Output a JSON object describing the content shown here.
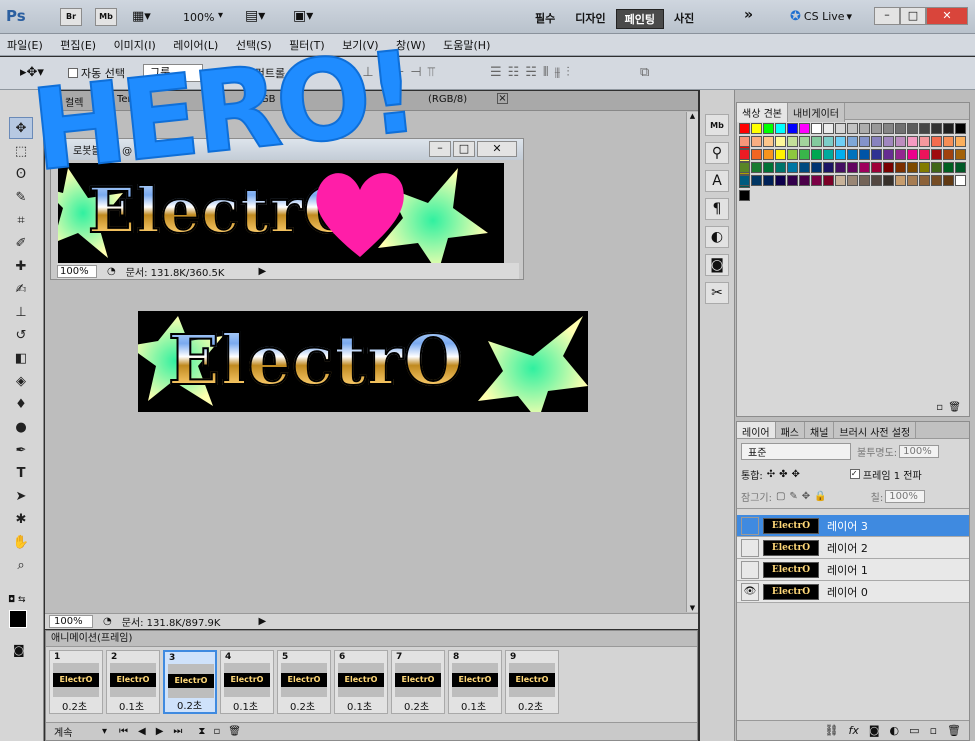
{
  "app": {
    "logo": "Ps",
    "bridge": "Br",
    "minibridge": "Mb",
    "zoom": "100%",
    "workspaces": [
      "필수",
      "디자인",
      "페인팅",
      "사진"
    ],
    "active_workspace": "페인팅",
    "more": "»",
    "cs_live": "CS Live"
  },
  "menu": [
    "파일(E)",
    "편집(E)",
    "이미지(I)",
    "레이어(L)",
    "선택(S)",
    "필터(T)",
    "보기(V)",
    "창(W)",
    "도움말(H)"
  ],
  "options": {
    "auto_select": "자동 선택",
    "group_value": "그룹",
    "transform_controls": "변형 컨트롤 표시"
  },
  "overlay": {
    "hero_text": "HERO!"
  },
  "tabs": [
    {
      "label": "컬렉"
    },
    {
      "label": "Tenco"
    },
    {
      "label": "(RGB"
    },
    {
      "label": "(RGB/8)"
    }
  ],
  "small_doc": {
    "title": "로봇블니스 @ 100% (♥...",
    "zoom": "100%",
    "status": "문서: 131.8K/360.5K",
    "banner_text": "ElectrO"
  },
  "main_doc": {
    "banner_text": "ElectrO",
    "zoom": "100%",
    "status": "문서: 131.8K/897.9K"
  },
  "swatches_panel": {
    "tabs": [
      "색상 견본",
      "내비게이터"
    ]
  },
  "layers_panel": {
    "tabs": [
      "레이어",
      "패스",
      "채널",
      "브러시 사전 설정"
    ],
    "blend_mode": "표준",
    "opacity_label": "불투명도:",
    "opacity_value": "100%",
    "unify_label": "통합:",
    "propagate_label": "프레임 1 전파",
    "lock_label": "잠그기:",
    "fill_label": "칠:",
    "fill_value": "100%",
    "layers": [
      {
        "name": "레이어 3",
        "thumb": "ElectrO",
        "visible": false,
        "selected": true
      },
      {
        "name": "레이어 2",
        "thumb": "ElectrO",
        "visible": false,
        "selected": false
      },
      {
        "name": "레이어 1",
        "thumb": "ElectrO",
        "visible": false,
        "selected": false
      },
      {
        "name": "레이어 0",
        "thumb": "ElectrO",
        "visible": true,
        "selected": false
      }
    ]
  },
  "animation": {
    "title": "애니메이션(프레임)",
    "loop": "계속",
    "frames": [
      {
        "num": "1",
        "delay": "0.2초",
        "thumb": "ElectrO"
      },
      {
        "num": "2",
        "delay": "0.1초",
        "thumb": "ElectrO"
      },
      {
        "num": "3",
        "delay": "0.2초",
        "thumb": "ElectrO"
      },
      {
        "num": "4",
        "delay": "0.1초",
        "thumb": "ElectrO"
      },
      {
        "num": "5",
        "delay": "0.2초",
        "thumb": "ElectrO"
      },
      {
        "num": "6",
        "delay": "0.1초",
        "thumb": "ElectrO"
      },
      {
        "num": "7",
        "delay": "0.2초",
        "thumb": "ElectrO"
      },
      {
        "num": "8",
        "delay": "0.1초",
        "thumb": "ElectrO"
      },
      {
        "num": "9",
        "delay": "0.2초",
        "thumb": "ElectrO"
      }
    ]
  },
  "colors": {
    "accent": "#3f8ae0",
    "hero": "#1f8cff",
    "heart": "#ff1ea8",
    "swatch_rows": [
      [
        "#ff0000",
        "#ffff00",
        "#00ff00",
        "#00ffff",
        "#0000ff",
        "#ff00ff",
        "#ffffff",
        "#ebebeb",
        "#d6d6d6",
        "#c2c2c2",
        "#adadad",
        "#999999",
        "#858585",
        "#707070",
        "#5c5c5c",
        "#474747",
        "#333333",
        "#1f1f1f",
        "#000000",
        "#ff0000"
      ],
      [
        "#f7977a",
        "#f9ad81",
        "#fdc68a",
        "#fff79a",
        "#c4df9b",
        "#a2d39c",
        "#82ca9d",
        "#7bcdc8",
        "#6ecff6",
        "#7ea7d8",
        "#8493ca",
        "#8882be",
        "#a187be",
        "#bc8dbf",
        "#f49ac2",
        "#f6989d",
        "#f26c4f",
        "#f68e55",
        "#fbaf5c",
        "#fff467"
      ],
      [
        "#ed1c24",
        "#f26522",
        "#f7941d",
        "#fff200",
        "#8dc73f",
        "#39b54a",
        "#00a651",
        "#00a99d",
        "#00aeef",
        "#0072bc",
        "#0054a6",
        "#2e3192",
        "#662d91",
        "#92278f",
        "#ec008c",
        "#ed145b",
        "#9e0b0f",
        "#a0410d",
        "#a36209",
        "#aba000"
      ],
      [
        "#598527",
        "#197b30",
        "#007236",
        "#00746b",
        "#0076a3",
        "#004b80",
        "#003471",
        "#1b1464",
        "#440e62",
        "#630460",
        "#9e005d",
        "#9e0039",
        "#790000",
        "#7b2e00",
        "#7d4900",
        "#827b00",
        "#406618",
        "#005e20",
        "#005826",
        "#005952"
      ],
      [
        "#005b7f",
        "#003663",
        "#002157",
        "#0d004c",
        "#32004b",
        "#4b0049",
        "#7b0046",
        "#7a0026",
        "#c7b299",
        "#998675",
        "#736357",
        "#534741",
        "#37302a",
        "#c69c6d",
        "#a67c52",
        "#8c6239",
        "#754c24",
        "#603913",
        "#ffffff",
        "#000000"
      ]
    ]
  }
}
